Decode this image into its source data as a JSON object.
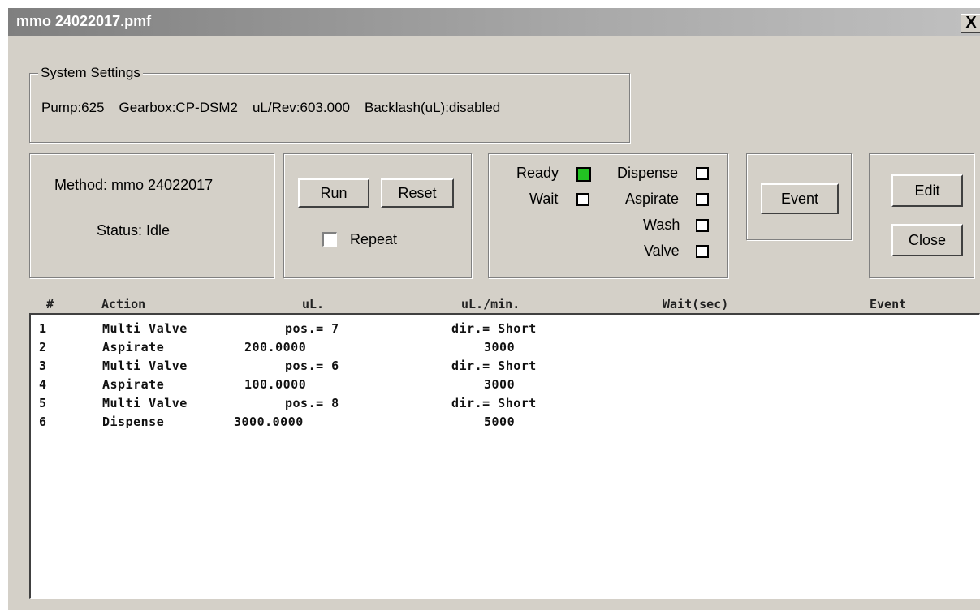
{
  "window": {
    "title": "mmo 24022017.pmf",
    "close_glyph": "X"
  },
  "system_settings": {
    "legend": "System Settings",
    "pump": "Pump:625",
    "gearbox": "Gearbox:CP-DSM2",
    "ul_rev": "uL/Rev:603.000",
    "backlash": "Backlash(uL):disabled"
  },
  "method_panel": {
    "method": "Method: mmo 24022017",
    "status": "Status: Idle"
  },
  "run_panel": {
    "run_label": "Run",
    "reset_label": "Reset",
    "repeat_label": "Repeat",
    "repeat_checked": false
  },
  "indicators": {
    "ready": "Ready",
    "ready_color": "#22c322",
    "wait": "Wait",
    "dispense": "Dispense",
    "aspirate": "Aspirate",
    "wash": "Wash",
    "valve": "Valve"
  },
  "event_panel": {
    "event_label": "Event"
  },
  "edit_panel": {
    "edit_label": "Edit",
    "close_label": "Close"
  },
  "table": {
    "headers": [
      "#",
      "Action",
      "uL.",
      "uL./min.",
      "Wait(sec)",
      "Event"
    ],
    "rows": [
      {
        "num": "1",
        "action": "Multi Valve",
        "ul": "pos.= 7",
        "ulmin": "dir.= Short"
      },
      {
        "num": "2",
        "action": "Aspirate",
        "ul": "200.0000",
        "ulmin": "3000"
      },
      {
        "num": "3",
        "action": "Multi Valve",
        "ul": "pos.= 6",
        "ulmin": "dir.= Short"
      },
      {
        "num": "4",
        "action": "Aspirate",
        "ul": "100.0000",
        "ulmin": "3000"
      },
      {
        "num": "5",
        "action": "Multi Valve",
        "ul": "pos.= 8",
        "ulmin": "dir.= Short"
      },
      {
        "num": "6",
        "action": "Dispense",
        "ul": "3000.0000",
        "ulmin": "5000"
      }
    ]
  }
}
